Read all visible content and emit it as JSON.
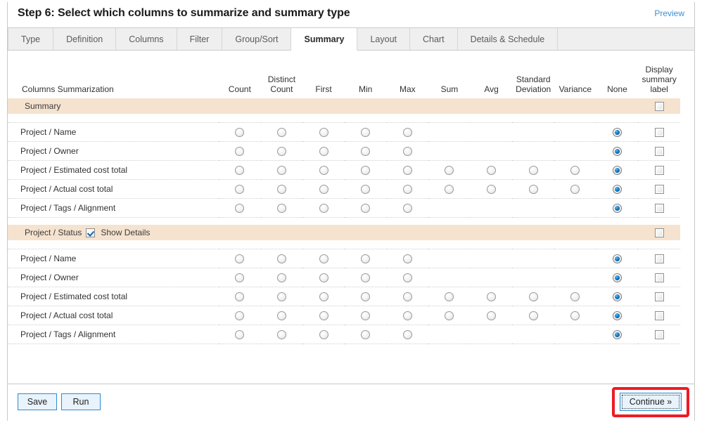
{
  "header": {
    "title": "Step 6: Select which columns to summarize and summary type",
    "preview_label": "Preview"
  },
  "tabs": [
    {
      "label": "Type",
      "active": false
    },
    {
      "label": "Definition",
      "active": false
    },
    {
      "label": "Columns",
      "active": false
    },
    {
      "label": "Filter",
      "active": false
    },
    {
      "label": "Group/Sort",
      "active": false
    },
    {
      "label": "Summary",
      "active": true
    },
    {
      "label": "Layout",
      "active": false
    },
    {
      "label": "Chart",
      "active": false
    },
    {
      "label": "Details & Schedule",
      "active": false
    }
  ],
  "grid": {
    "lead_header": "Columns Summarization",
    "columns": [
      {
        "key": "count",
        "label": "Count"
      },
      {
        "key": "dcount",
        "label": "Distinct\nCount"
      },
      {
        "key": "first",
        "label": "First"
      },
      {
        "key": "min",
        "label": "Min"
      },
      {
        "key": "max",
        "label": "Max"
      },
      {
        "key": "sum",
        "label": "Sum"
      },
      {
        "key": "avg",
        "label": "Avg"
      },
      {
        "key": "stdev",
        "label": "Standard\nDeviation"
      },
      {
        "key": "variance",
        "label": "Variance"
      },
      {
        "key": "none",
        "label": "None"
      }
    ],
    "display_label_header": "Display\nsummary\nlabel",
    "groups": [
      {
        "band": {
          "label": "Summary",
          "has_show_details": false,
          "show_details_label": "",
          "show_details_checked": false,
          "display_label_checked": false
        },
        "rows": [
          {
            "label": "Project / Name",
            "radios": [
              "off",
              "off",
              "off",
              "off",
              "off",
              null,
              null,
              null,
              null,
              "on"
            ],
            "display_label_checked": false
          },
          {
            "label": "Project / Owner",
            "radios": [
              "off",
              "off",
              "off",
              "off",
              "off",
              null,
              null,
              null,
              null,
              "on"
            ],
            "display_label_checked": false
          },
          {
            "label": "Project / Estimated cost total",
            "radios": [
              "off",
              "off",
              "off",
              "off",
              "off",
              "off",
              "off",
              "off",
              "off",
              "on"
            ],
            "display_label_checked": false
          },
          {
            "label": "Project / Actual cost total",
            "radios": [
              "off",
              "off",
              "off",
              "off",
              "off",
              "off",
              "off",
              "off",
              "off",
              "on"
            ],
            "display_label_checked": false
          },
          {
            "label": "Project / Tags / Alignment",
            "radios": [
              "off",
              "off",
              "off",
              "off",
              "off",
              null,
              null,
              null,
              null,
              "on"
            ],
            "display_label_checked": false
          }
        ]
      },
      {
        "band": {
          "label": "Project / Status",
          "has_show_details": true,
          "show_details_label": "Show Details",
          "show_details_checked": true,
          "display_label_checked": false
        },
        "rows": [
          {
            "label": "Project / Name",
            "radios": [
              "off",
              "off",
              "off",
              "off",
              "off",
              null,
              null,
              null,
              null,
              "on"
            ],
            "display_label_checked": false
          },
          {
            "label": "Project / Owner",
            "radios": [
              "off",
              "off",
              "off",
              "off",
              "off",
              null,
              null,
              null,
              null,
              "on"
            ],
            "display_label_checked": false
          },
          {
            "label": "Project / Estimated cost total",
            "radios": [
              "off",
              "off",
              "off",
              "off",
              "off",
              "off",
              "off",
              "off",
              "off",
              "on"
            ],
            "display_label_checked": false
          },
          {
            "label": "Project / Actual cost total",
            "radios": [
              "off",
              "off",
              "off",
              "off",
              "off",
              "off",
              "off",
              "off",
              "off",
              "on"
            ],
            "display_label_checked": false
          },
          {
            "label": "Project / Tags / Alignment",
            "radios": [
              "off",
              "off",
              "off",
              "off",
              "off",
              null,
              null,
              null,
              null,
              "on"
            ],
            "display_label_checked": false
          }
        ]
      }
    ]
  },
  "footer": {
    "save_label": "Save",
    "run_label": "Run",
    "continue_label": "Continue »",
    "continue_highlight_color": "#ee1b24"
  }
}
